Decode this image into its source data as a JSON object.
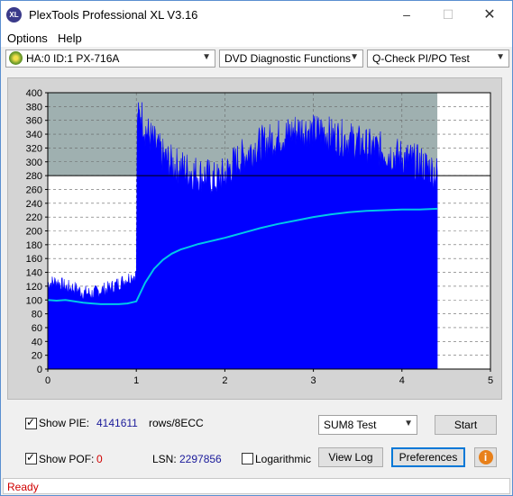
{
  "window": {
    "title": "PlexTools Professional XL V3.16",
    "icon_label": "XL"
  },
  "menu": [
    {
      "label": "Options"
    },
    {
      "label": "Help"
    }
  ],
  "toolbar": {
    "drive": "HA:0 ID:1  PX-716A",
    "function": "DVD Diagnostic Functions",
    "test": "Q-Check PI/PO Test"
  },
  "chart_data": {
    "type": "area",
    "title": "",
    "xlabel": "",
    "ylabel": "",
    "xlim": [
      0,
      5
    ],
    "ylim": [
      0,
      400
    ],
    "x_ticks": [
      "0",
      "1",
      "2",
      "3",
      "4",
      "5"
    ],
    "y_ticks": [
      "0",
      "20",
      "40",
      "60",
      "80",
      "100",
      "120",
      "140",
      "160",
      "180",
      "200",
      "220",
      "240",
      "260",
      "280",
      "300",
      "320",
      "340",
      "360",
      "380",
      "400"
    ],
    "threshold_line": 280,
    "data_end_x": 4.4,
    "colors": {
      "bars": "#0000ff",
      "line": "#00c8e8",
      "plot_bg_top": "#9fb0b0",
      "plot_bg": "#ffffff",
      "threshold": "#000000"
    },
    "series": [
      {
        "type": "bars",
        "x": [
          0.0,
          0.1,
          0.2,
          0.3,
          0.4,
          0.5,
          0.6,
          0.7,
          0.8,
          0.9,
          1.0,
          1.01,
          1.05,
          1.1,
          1.2,
          1.3,
          1.4,
          1.5,
          1.6,
          1.7,
          1.8,
          1.9,
          2.0,
          2.1,
          2.2,
          2.3,
          2.4,
          2.5,
          2.6,
          2.7,
          2.8,
          2.9,
          3.0,
          3.1,
          3.2,
          3.3,
          3.4,
          3.5,
          3.6,
          3.7,
          3.8,
          3.9,
          4.0,
          4.1,
          4.2,
          4.3,
          4.4
        ],
        "values": [
          125,
          128,
          120,
          118,
          112,
          110,
          115,
          118,
          125,
          132,
          138,
          360,
          375,
          350,
          330,
          310,
          300,
          295,
          290,
          285,
          282,
          275,
          285,
          300,
          310,
          320,
          328,
          332,
          338,
          342,
          348,
          350,
          345,
          348,
          340,
          338,
          335,
          330,
          325,
          322,
          318,
          312,
          310,
          305,
          300,
          295,
          285
        ]
      },
      {
        "type": "line",
        "x": [
          0.0,
          0.1,
          0.2,
          0.3,
          0.4,
          0.5,
          0.6,
          0.7,
          0.8,
          0.9,
          1.0,
          1.1,
          1.2,
          1.3,
          1.4,
          1.5,
          1.6,
          1.7,
          1.8,
          1.9,
          2.0,
          2.2,
          2.4,
          2.6,
          2.8,
          3.0,
          3.2,
          3.4,
          3.6,
          3.8,
          4.0,
          4.2,
          4.4
        ],
        "values": [
          100,
          99,
          100,
          98,
          96,
          95,
          94,
          94,
          94,
          95,
          98,
          125,
          145,
          158,
          167,
          173,
          177,
          181,
          184,
          187,
          190,
          197,
          204,
          210,
          215,
          220,
          224,
          227,
          229,
          230,
          231,
          231,
          232
        ]
      }
    ]
  },
  "panel": {
    "show_pie_label": "Show PIE:",
    "pie_value": "4141611",
    "pie_unit": "rows/8ECC",
    "show_pof_label": "Show POF:",
    "pof_value": "0",
    "lsn_label": "LSN:",
    "lsn_value": "2297856",
    "log_label": "Logarithmic",
    "sum_select": "SUM8 Test",
    "start_button": "Start",
    "view_log_button": "View Log",
    "preferences_button": "Preferences",
    "info_icon": "i"
  },
  "status": {
    "text": "Ready"
  }
}
